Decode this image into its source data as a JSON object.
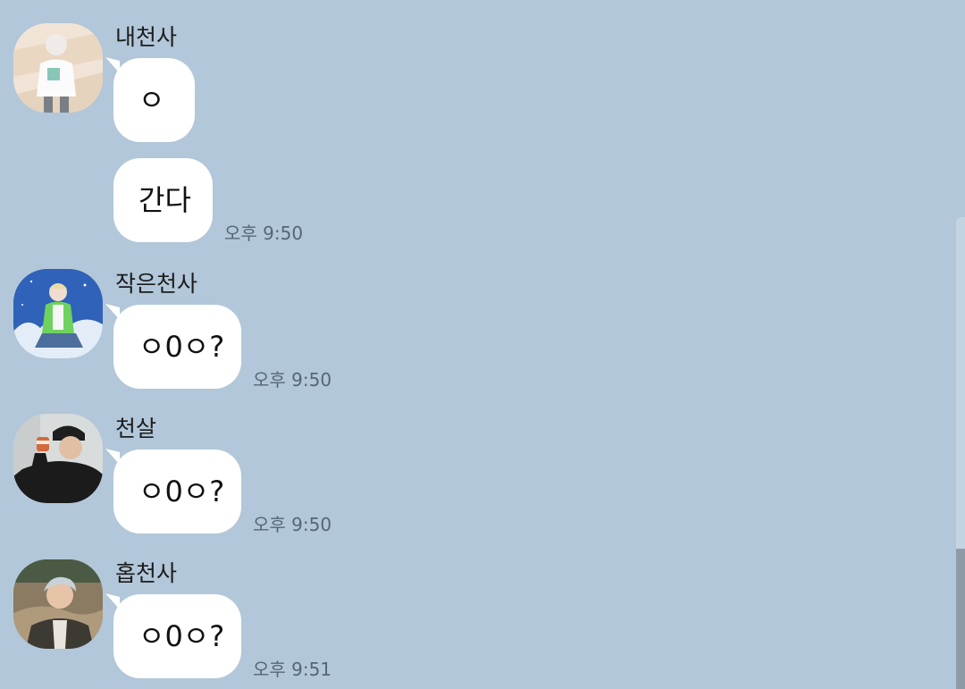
{
  "colors": {
    "background": "#b2c7d9",
    "bubble": "#ffffff",
    "sender_text": "#1c1c1c",
    "message_text": "#111111",
    "timestamp_text": "#556677",
    "scrollbar_track": "#c3d3e0",
    "scrollbar_thumb": "#8e9ba6"
  },
  "messages": [
    {
      "sender": "내천사",
      "avatar": "user-avatar-icon",
      "bubbles": [
        {
          "text": "ㅇ",
          "time": ""
        },
        {
          "text": "간다",
          "time": "오후 9:50"
        }
      ]
    },
    {
      "sender": "작은천사",
      "avatar": "user-avatar-icon",
      "bubbles": [
        {
          "text": "ㅇ0ㅇ?",
          "time": "오후 9:50"
        }
      ]
    },
    {
      "sender": "천살",
      "avatar": "user-avatar-icon",
      "bubbles": [
        {
          "text": "ㅇ0ㅇ?",
          "time": "오후 9:50"
        }
      ]
    },
    {
      "sender": "홉천사",
      "avatar": "user-avatar-icon",
      "bubbles": [
        {
          "text": "ㅇ0ㅇ?",
          "time": "오후 9:51"
        }
      ]
    }
  ]
}
